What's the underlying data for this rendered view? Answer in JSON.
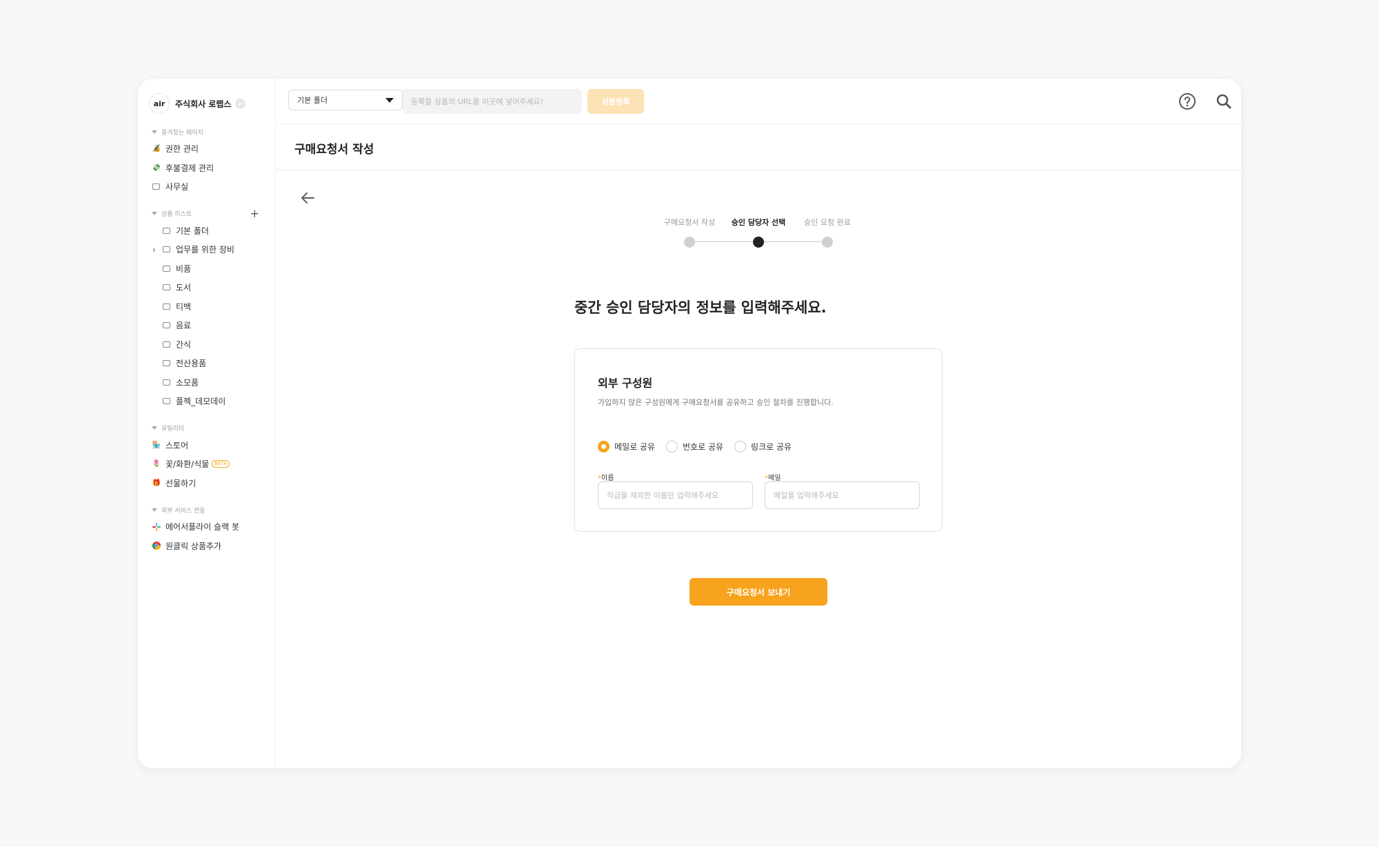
{
  "sidebar": {
    "logo_text": "air",
    "company_name": "주식회사 로랩스",
    "favorites": {
      "title": "즐겨찾는 페이지",
      "items": [
        {
          "label": "권한 관리",
          "icon": "key-badge-icon"
        },
        {
          "label": "후불결제 관리",
          "icon": "money-icon"
        },
        {
          "label": "사무실",
          "icon": "folder-icon"
        }
      ]
    },
    "product_list": {
      "title": "상품 리스트",
      "add_icon": "plus-icon",
      "items": [
        {
          "label": "기본 폴더"
        },
        {
          "label": "업무를 위한 장비"
        },
        {
          "label": "비품"
        },
        {
          "label": "도서"
        },
        {
          "label": "티백"
        },
        {
          "label": "음료"
        },
        {
          "label": "간식"
        },
        {
          "label": "전산용품"
        },
        {
          "label": "소모품"
        },
        {
          "label": "플젝_데모데이"
        }
      ]
    },
    "utility": {
      "title": "유틸리티",
      "items": [
        {
          "label": "스토어",
          "icon": "store-icon"
        },
        {
          "label": "꽃/화환/식물",
          "icon": "flower-icon",
          "badge": "BETA"
        },
        {
          "label": "선물하기",
          "icon": "gift-icon"
        }
      ]
    },
    "external": {
      "title": "외부 서비스 연동",
      "items": [
        {
          "label": "에어서플라이 슬랙 봇",
          "icon": "slack-icon"
        },
        {
          "label": "원클릭 상품추가",
          "icon": "chrome-icon"
        }
      ]
    }
  },
  "topbar": {
    "folder_select_value": "기본 폴더",
    "url_placeholder": "등록할 상품의 URL을 이곳에 넣어주세요!",
    "register_label": "상품등록",
    "icons": [
      "help-icon",
      "search-icon",
      "cart-icon",
      "bell-icon",
      "avatar"
    ]
  },
  "page": {
    "title": "구매요청서 작성",
    "steps": [
      {
        "label": "구매요청서 작성",
        "active": false
      },
      {
        "label": "승인 담당자 선택",
        "active": true
      },
      {
        "label": "승인 요청 완료",
        "active": false
      }
    ],
    "heading": "중간 승인 담당자의 정보를 입력해주세요.",
    "card": {
      "title": "외부 구성원",
      "description": "가입하지 않은 구성원에게 구매요청서를 공유하고 승인 절차를 진행합니다.",
      "share_options": [
        {
          "label": "메일로 공유",
          "selected": true
        },
        {
          "label": "번호로 공유",
          "selected": false
        },
        {
          "label": "링크로 공유",
          "selected": false
        }
      ],
      "required_mark": "*",
      "name_label": "이름",
      "name_placeholder": "직급을 제외한 이름만 입력해주세요",
      "email_label": "메일",
      "email_placeholder": "메일을 입력해주세요"
    },
    "submit_label": "구매요청서 보내기"
  },
  "colors": {
    "accent": "#f8a31d",
    "accent_light": "#fde2b5",
    "notification_dot": "#e8473c"
  }
}
